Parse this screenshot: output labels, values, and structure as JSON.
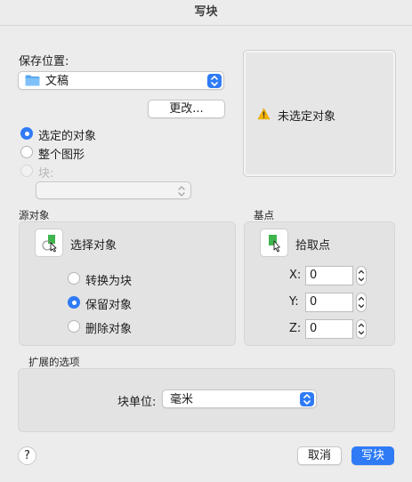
{
  "dialog": {
    "title": "写块"
  },
  "save_location": {
    "label": "保存位置:",
    "selected": "文稿",
    "folder_icon": "folder-icon",
    "change_button": "更改..."
  },
  "source": {
    "options": [
      {
        "label": "选定的对象",
        "checked": true,
        "enabled": true
      },
      {
        "label": "整个图形",
        "checked": false,
        "enabled": true
      },
      {
        "label": "块:",
        "checked": false,
        "enabled": false
      }
    ],
    "block_select_value": ""
  },
  "preview": {
    "warning_icon": "warning-icon",
    "message": "未选定对象"
  },
  "source_objects": {
    "label": "源对象",
    "select_button": "选择对象",
    "options": [
      {
        "label": "转换为块",
        "checked": false
      },
      {
        "label": "保留对象",
        "checked": true
      },
      {
        "label": "删除对象",
        "checked": false
      }
    ]
  },
  "base_point": {
    "label": "基点",
    "pick_button": "拾取点",
    "x_label": "X:",
    "x_value": "0",
    "y_label": "Y:",
    "y_value": "0",
    "z_label": "Z:",
    "z_value": "0"
  },
  "extended": {
    "label": "扩展的选项",
    "unit_label": "块单位:",
    "unit_value": "毫米"
  },
  "footer": {
    "help": "?",
    "cancel": "取消",
    "ok": "写块"
  },
  "colors": {
    "accent": "#2f7bf6",
    "warning": "#f5b400"
  }
}
